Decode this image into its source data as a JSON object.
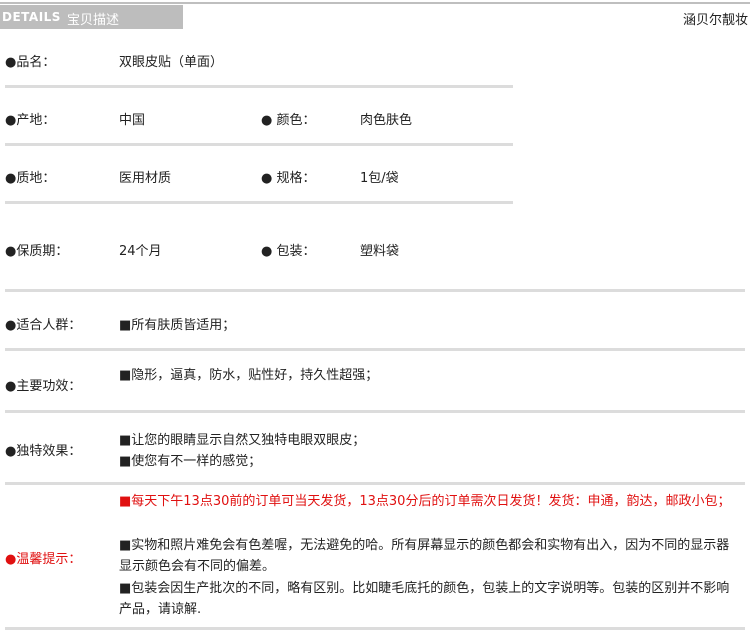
{
  "header": {
    "en_label": "DETAILS",
    "cn_label": "宝贝描述",
    "brand": "涵贝尔靓妆"
  },
  "rows": [
    {
      "label": "●品名：",
      "value": "双眼皮贴（单面）"
    },
    {
      "label": "●产地：",
      "value": "中国",
      "label2": "●  颜色：",
      "value2": "肉色肤色"
    },
    {
      "label": "●质地：",
      "value": "医用材质",
      "label2": "●  规格：",
      "value2": "1包/袋"
    },
    {
      "label": "●保质期：",
      "value": "24个月",
      "label2": "●  包装：",
      "value2": "塑料袋"
    },
    {
      "label": "●适合人群：",
      "value": "■所有肤质皆适用；"
    },
    {
      "label": "●主要功效：",
      "value": "■隐形，逼真，防水，贴性好，持久性超强；"
    },
    {
      "label": "●独特效果：",
      "lines": [
        "■让您的眼睛显示自然又独特电眼双眼皮；",
        "■使您有不一样的感觉；"
      ]
    }
  ],
  "notice": {
    "label": "●温馨提示：",
    "red_text": "■每天下午13点30前的订单可当天发货，13点30分后的订单需次日发货！发货：申通，韵达，邮政小包；",
    "line2": "■实物和照片难免会有色差喔，无法避免的哈。所有屏幕显示的颜色都会和实物有出入，因为不同的显示器显示颜色会有不同的偏差。",
    "line3": "■包装会因生产批次的不同，略有区别。比如睫毛底托的颜色，包装上的文字说明等。包装的区别并不影响产品，请谅解."
  }
}
